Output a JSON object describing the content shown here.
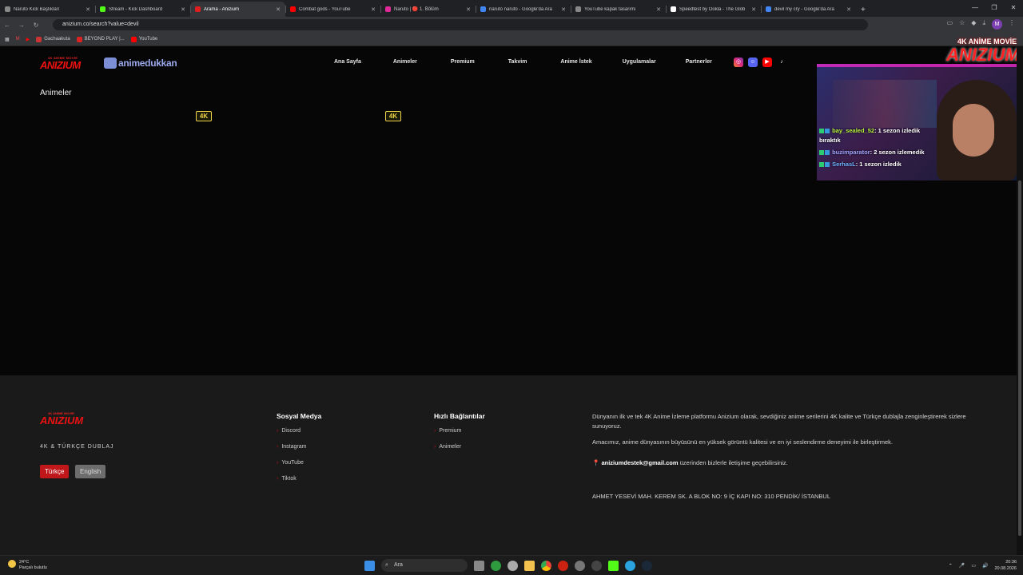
{
  "browser": {
    "tabs": [
      {
        "title": "Naruto Kick Başlıkları",
        "color": "#888888"
      },
      {
        "title": "Stream - Kick Dashboard",
        "color": "#53fc18"
      },
      {
        "title": "Arama - Anizium",
        "color": "#e11d1d"
      },
      {
        "title": "Combat gods - YouTube",
        "color": "#ff0000"
      },
      {
        "title": "Naruto | 🔴 1. Bölüm",
        "color": "#e02a9a"
      },
      {
        "title": "naruto naruto - Google'da Ara",
        "color": "#4285f4"
      },
      {
        "title": "YouTube kapak tasarımı",
        "color": "#888888"
      },
      {
        "title": "Speedtest by Ookla - The Glob",
        "color": "#ffffff"
      },
      {
        "title": "devil my cry - Google'da Ara",
        "color": "#4285f4"
      }
    ],
    "new_tab": "+",
    "url": "anizium.co/search?value=devil",
    "bookmarks": [
      "Gachaakuta",
      "BEYOND PLAY |...",
      "YouTube"
    ]
  },
  "site": {
    "logo_small": "4K ANİME MOVİE",
    "logo_big": "ANIZIUM",
    "partner_logo": "animedukkan",
    "nav": [
      "Ana Sayfa",
      "Animeler",
      "Premium",
      "Takvim",
      "Anime İstek",
      "Uygulamalar",
      "Partnerler"
    ],
    "social_icons": [
      "instagram-icon",
      "discord-icon",
      "youtube-icon",
      "tiktok-icon"
    ],
    "page_title": "Animeler",
    "badges": [
      "4K",
      "4K"
    ]
  },
  "stream": {
    "brand_small": "4K ANİME MOVİE",
    "brand_big": "ANIZIUM",
    "chat": [
      {
        "user": "bay_sealed_52",
        "message": ": 1 sezon izledik bıraktık"
      },
      {
        "user": "buzimparator",
        "message": ": 2 sezon izlemedik"
      },
      {
        "user": "SerhasL",
        "message": ": 1 sezon izledik"
      }
    ]
  },
  "footer": {
    "tagline": "4K & TÜRKÇE DUBLAJ",
    "lang_tr": "Türkçe",
    "lang_en": "English",
    "social_title": "Sosyal Medya",
    "social_links": [
      "Discord",
      "Instagram",
      "YouTube",
      "Tiktok"
    ],
    "quick_title": "Hızlı Bağlantılar",
    "quick_links": [
      "Premium",
      "Animeler"
    ],
    "about_1": "Dünyanın ilk ve tek 4K Anime İzleme platformu Anizium olarak, sevdiğiniz anime serilerini 4K kalite ve Türkçe dublajla zenginleştirerek sizlere sunuyoruz.",
    "about_2": "Amacımız, anime dünyasının büyüsünü en yüksek görüntü kalitesi ve en iyi seslendirme deneyimi ile birleştirmek.",
    "email": "aniziumdestek@gmail.com",
    "email_suffix": " üzerinden bizlerle iletişime geçebilirsiniz.",
    "address": "AHMET YESEVİ MAH. KEREM SK. A BLOK NO: 9 İÇ KAPI NO: 310 PENDİK/ İSTANBUL"
  },
  "taskbar": {
    "temp": "24°C",
    "weather": "Parçalı bulutlu",
    "search": "Ara",
    "time": "20:36",
    "date": "20.08.2026"
  },
  "colors": {
    "brand_red": "#e11d1d",
    "badge_yellow": "#f1d34a"
  }
}
